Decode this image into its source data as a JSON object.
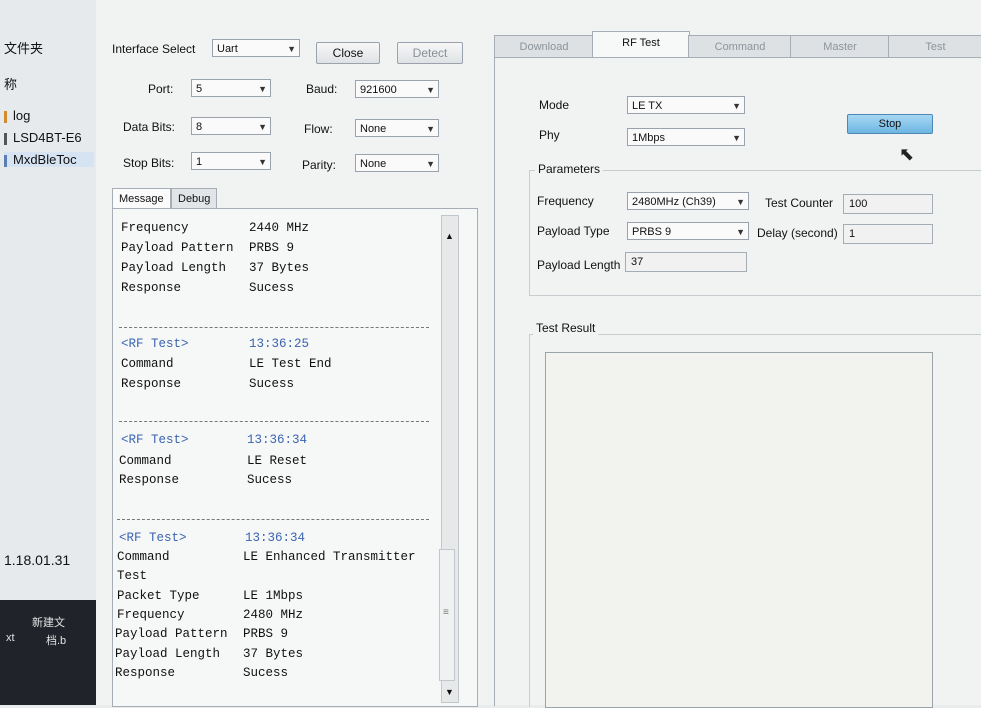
{
  "explorer": {
    "items": [
      "文件夹",
      "称",
      "log",
      "LSD4BT-E6",
      "MxdBleToc"
    ],
    "version": "1.18.01.31",
    "taskbar": [
      "新建文",
      "xt",
      "档.b"
    ]
  },
  "interface": {
    "label": "Interface Select",
    "value": "Uart",
    "close_label": "Close",
    "detect_label": "Detect"
  },
  "serial": {
    "port_label": "Port:",
    "port": "5",
    "baud_label": "Baud:",
    "baud": "921600",
    "databits_label": "Data Bits:",
    "databits": "8",
    "flow_label": "Flow:",
    "flow": "None",
    "stopbits_label": "Stop Bits:",
    "stopbits": "1",
    "parity_label": "Parity:",
    "parity": "None"
  },
  "msg_tabs": [
    "Message",
    "Debug"
  ],
  "log": {
    "top": [
      [
        "Frequency",
        "2440 MHz"
      ],
      [
        "Payload Pattern",
        "PRBS 9"
      ],
      [
        "Payload Length",
        "37 Bytes"
      ],
      [
        "Response",
        "Sucess"
      ]
    ],
    "entries": [
      {
        "head": "<RF Test>",
        "time": "13:36:25",
        "lines": [
          [
            "Command",
            "LE Test End"
          ],
          [
            "Response",
            "Sucess"
          ]
        ]
      },
      {
        "head": "<RF Test>",
        "time": "13:36:34",
        "lines": [
          [
            "Command",
            "LE Reset"
          ],
          [
            "Response",
            "Sucess"
          ]
        ]
      },
      {
        "head": "<RF Test>",
        "time": "13:36:34",
        "lines": [
          [
            "Command",
            "LE Enhanced Transmitter"
          ],
          [
            "Test",
            ""
          ],
          [
            "Packet Type",
            "LE 1Mbps"
          ],
          [
            "Frequency",
            "2480 MHz"
          ],
          [
            "Payload Pattern",
            "PRBS 9"
          ],
          [
            "Payload Length",
            "37 Bytes"
          ],
          [
            "Response",
            "Sucess"
          ]
        ]
      }
    ]
  },
  "right_tabs": [
    "Download",
    "RF Test",
    "Command",
    "Master",
    "Test"
  ],
  "rf": {
    "mode_label": "Mode",
    "mode": "LE TX",
    "phy_label": "Phy",
    "phy": "1Mbps",
    "stop_label": "Stop",
    "params_label": "Parameters",
    "freq_label": "Frequency",
    "freq": "2480MHz (Ch39)",
    "counter_label": "Test Counter",
    "counter": "100",
    "ptype_label": "Payload Type",
    "ptype": "PRBS 9",
    "delay_label": "Delay (second)",
    "delay": "1",
    "plen_label": "Payload Length",
    "plen": "37",
    "result_label": "Test Result"
  }
}
